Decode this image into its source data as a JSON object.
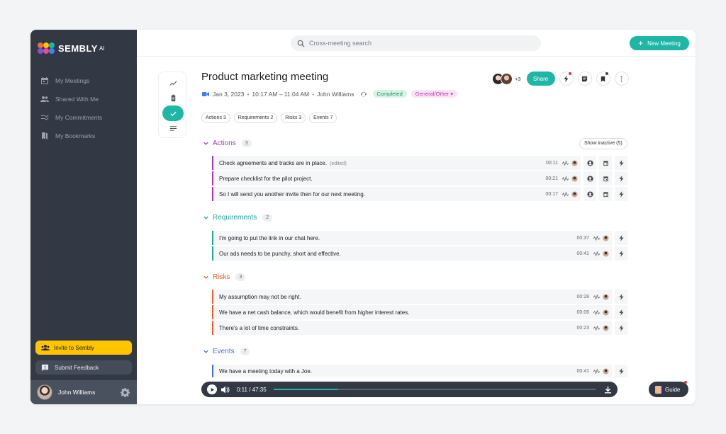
{
  "brand": {
    "name": "SEMBLY",
    "suffix": "AI"
  },
  "sidebar": {
    "items": [
      {
        "label": "My Meetings",
        "icon": "calendar-icon"
      },
      {
        "label": "Shared With Me",
        "icon": "people-icon"
      },
      {
        "label": "My Commitments",
        "icon": "checklist-icon"
      },
      {
        "label": "My Bookmarks",
        "icon": "bookmarks-icon"
      }
    ],
    "invite_label": "Invite to Sembly",
    "feedback_label": "Submit Feedback",
    "user_name": "John Williams"
  },
  "topbar": {
    "search_placeholder": "Cross-meeting search",
    "new_meeting_label": "New Meeting"
  },
  "meeting": {
    "title": "Product marketing meeting",
    "date": "Jan 3, 2023",
    "time": "10:17 AM – 11:04 AM",
    "owner": "John Williams",
    "status": "Completed",
    "category": "General/Other",
    "participants_more": "+3",
    "share_label": "Share"
  },
  "filters": [
    "Actions 3",
    "Requirements 2",
    "Risks 3",
    "Events 7"
  ],
  "show_inactive_label": "Show inactive (5)",
  "colors": {
    "accent": "#1fb6a6",
    "actions": "#a43ab8",
    "requirements": "#1fa89a",
    "risks": "#e8602c",
    "events": "#4b6bd6",
    "sidebar_bg": "#323844",
    "invite_bg": "#ffc600"
  },
  "sections": {
    "actions": {
      "title": "Actions",
      "count": "3",
      "items": [
        {
          "text": "Check agreements and tracks are in place.",
          "note": "(edited)",
          "time": "00:11"
        },
        {
          "text": "Prepare checklist for the pilot project.",
          "time": "00:21"
        },
        {
          "text": "So I will send you another invite then for our next meeting.",
          "time": "00:17"
        }
      ]
    },
    "requirements": {
      "title": "Requirements",
      "count": "2",
      "items": [
        {
          "text": "I'm going to put the link in our chat here.",
          "time": "00:37"
        },
        {
          "text": "Our ads needs to be punchy, short and effective.",
          "time": "00:41"
        }
      ]
    },
    "risks": {
      "title": "Risks",
      "count": "3",
      "items": [
        {
          "text": "My assumption may not be right.",
          "time": "00:28"
        },
        {
          "text": "We have a net cash balance, which would benefit from higher interest rates.",
          "time": "00:06"
        },
        {
          "text": "There's a lot of time constraints.",
          "time": "00:23"
        }
      ]
    },
    "events": {
      "title": "Events",
      "count": "7",
      "items": [
        {
          "text": "We have a meeting today with a Joe.",
          "time": "00:41"
        }
      ]
    }
  },
  "player": {
    "current": "0:11",
    "total": "47:35",
    "time_display": "0:11 / 47:35",
    "progress_fraction": 0.2
  },
  "guide_label": "Guide"
}
